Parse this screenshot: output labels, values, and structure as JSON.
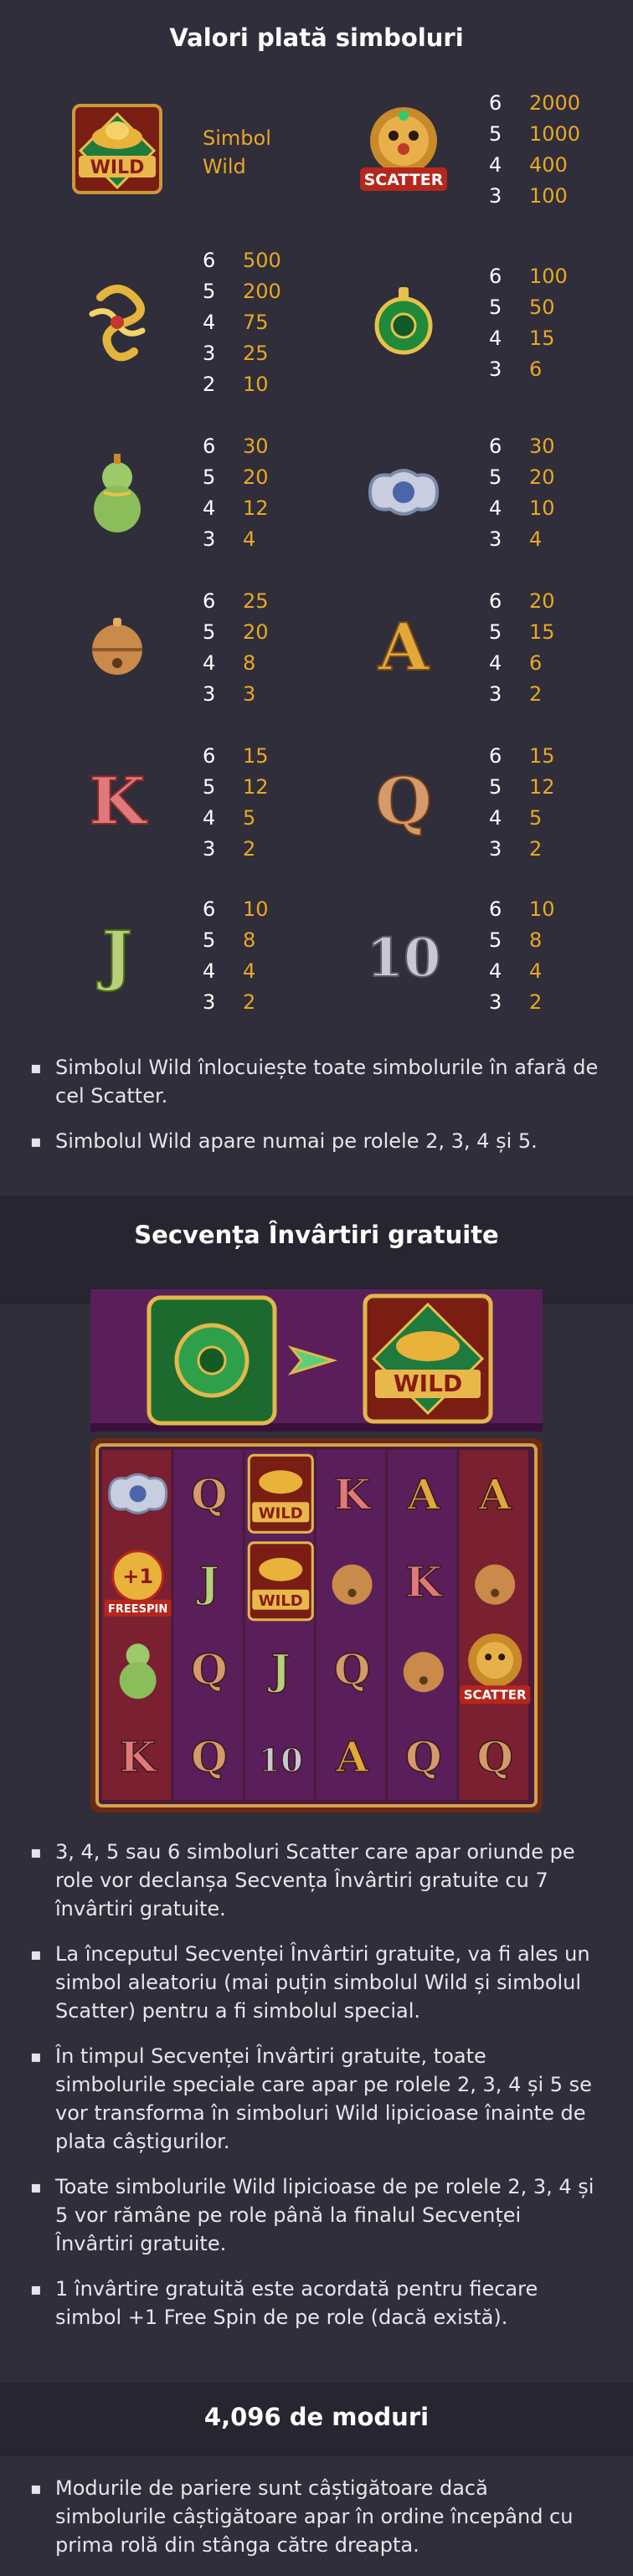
{
  "sections": {
    "paytable_title": "Valori plată simboluri",
    "freespins_title": "Secvența Învârtiri gratuite",
    "ways_title": "4,096 de moduri"
  },
  "symbols": {
    "wild": {
      "icon": "wild-ingot-icon",
      "label": "Simbol Wild"
    },
    "scatter": {
      "icon": "scatter-lion-icon",
      "pays": [
        [
          "6",
          "2000"
        ],
        [
          "5",
          "1000"
        ],
        [
          "4",
          "400"
        ],
        [
          "3",
          "100"
        ]
      ]
    },
    "knot": {
      "icon": "chinese-knot-icon",
      "pays": [
        [
          "6",
          "500"
        ],
        [
          "5",
          "200"
        ],
        [
          "4",
          "75"
        ],
        [
          "3",
          "25"
        ],
        [
          "2",
          "10"
        ]
      ]
    },
    "jade": {
      "icon": "jade-pendant-icon",
      "pays": [
        [
          "6",
          "100"
        ],
        [
          "5",
          "50"
        ],
        [
          "4",
          "15"
        ],
        [
          "3",
          "6"
        ]
      ]
    },
    "gourd": {
      "icon": "gourd-icon",
      "pays": [
        [
          "6",
          "30"
        ],
        [
          "5",
          "20"
        ],
        [
          "4",
          "12"
        ],
        [
          "3",
          "4"
        ]
      ]
    },
    "lock": {
      "icon": "silver-lock-icon",
      "pays": [
        [
          "6",
          "30"
        ],
        [
          "5",
          "20"
        ],
        [
          "4",
          "10"
        ],
        [
          "3",
          "4"
        ]
      ]
    },
    "bell": {
      "icon": "bell-icon",
      "pays": [
        [
          "6",
          "25"
        ],
        [
          "5",
          "20"
        ],
        [
          "4",
          "8"
        ],
        [
          "3",
          "3"
        ]
      ]
    },
    "a": {
      "icon": "letter-a-icon",
      "glyph": "A",
      "pays": [
        [
          "6",
          "20"
        ],
        [
          "5",
          "15"
        ],
        [
          "4",
          "6"
        ],
        [
          "3",
          "2"
        ]
      ]
    },
    "k": {
      "icon": "letter-k-icon",
      "glyph": "K",
      "pays": [
        [
          "6",
          "15"
        ],
        [
          "5",
          "12"
        ],
        [
          "4",
          "5"
        ],
        [
          "3",
          "2"
        ]
      ]
    },
    "q": {
      "icon": "letter-q-icon",
      "glyph": "Q",
      "pays": [
        [
          "6",
          "15"
        ],
        [
          "5",
          "12"
        ],
        [
          "4",
          "5"
        ],
        [
          "3",
          "2"
        ]
      ]
    },
    "j": {
      "icon": "letter-j-icon",
      "glyph": "J",
      "pays": [
        [
          "6",
          "10"
        ],
        [
          "5",
          "8"
        ],
        [
          "4",
          "4"
        ],
        [
          "3",
          "2"
        ]
      ]
    },
    "ten": {
      "icon": "ten-icon",
      "glyph": "10",
      "pays": [
        [
          "6",
          "10"
        ],
        [
          "5",
          "8"
        ],
        [
          "4",
          "4"
        ],
        [
          "3",
          "2"
        ]
      ]
    }
  },
  "wild_rules": [
    "Simbolul Wild înlocuiește toate simbolurile în afară de cel Scatter.",
    "Simbolul Wild apare numai pe rolele 2, 3, 4 și 5."
  ],
  "freespin_image": {
    "wild_label": "WILD",
    "scatter_label": "SCATTER",
    "freespin_label": "FREESPIN",
    "plus_one": "+1",
    "grid": [
      [
        "lock",
        "q",
        "wild",
        "k",
        "a",
        "a"
      ],
      [
        "plus1",
        "j",
        "wild",
        "bell",
        "k",
        "bell"
      ],
      [
        "gourd",
        "q",
        "j",
        "q",
        "bell",
        "scatter"
      ],
      [
        "k",
        "q",
        "10",
        "a",
        "q",
        "q"
      ]
    ]
  },
  "freespin_rules": [
    "3, 4, 5 sau 6 simboluri Scatter care apar oriunde pe role vor declanșa Secvența Învârtiri gratuite cu 7 învârtiri gratuite.",
    "La începutul Secvenței Învârtiri gratuite, va fi ales un simbol aleatoriu (mai puțin simbolul Wild și simbolul Scatter) pentru a fi simbolul special.",
    "În timpul Secvenței Învârtiri gratuite, toate simbolurile speciale care apar pe rolele 2, 3, 4 și 5 se vor transforma în simboluri Wild lipicioase înainte de plata câștigurilor.",
    "Toate simbolurile Wild lipicioase de pe rolele 2, 3, 4 și 5 vor rămâne pe role până la finalul Secvenței Învârtiri gratuite.",
    "1 învârtire gratuită este acordată pentru fiecare simbol +1 Free Spin de pe role (dacă există)."
  ],
  "ways_rules": [
    "Modurile de pariere sunt câștigătoare dacă simbolurile câștigătoare apar în ordine începând cu prima rolă din stânga către dreapta."
  ]
}
